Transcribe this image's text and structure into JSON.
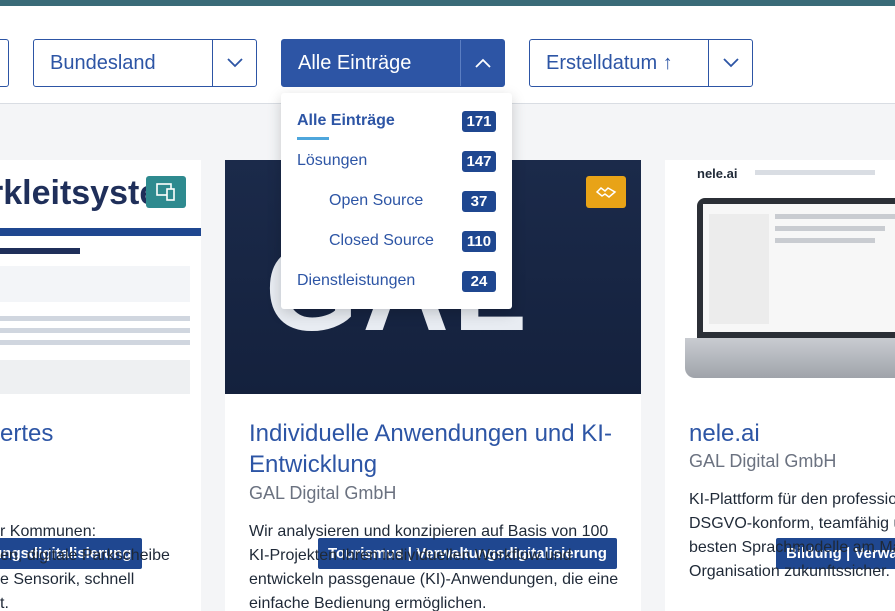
{
  "filters": {
    "bundesland": "Bundesland",
    "entries": "Alle Einträge",
    "sort": "Erstelldatum ↑"
  },
  "dropdown": {
    "options": [
      {
        "label": "Alle Einträge",
        "count": "171"
      },
      {
        "label": "Lösungen",
        "count": "147"
      },
      {
        "label": "Open Source",
        "count": "37"
      },
      {
        "label": "Closed Source",
        "count": "110"
      },
      {
        "label": "Dienstleistungen",
        "count": "24"
      }
    ]
  },
  "cards": [
    {
      "image_text": "rkleitsyster",
      "tag": "waltungsdigitalisierung",
      "title": "ertes",
      "description": [
        "r Kommunen:",
        "en, digitale Parkscheibe",
        "e Sensorik, schnell",
        "t."
      ],
      "icon": "devices-icon"
    },
    {
      "image_text": "GAL",
      "tag": "Tourismus | Verwaltungsdigitalisierung",
      "title": [
        "Individuelle Anwendungen und KI-",
        "Entwicklung"
      ],
      "company": "GAL Digital GmbH",
      "description": [
        "Wir analysieren und konzipieren auf Basis von 100",
        "KI-Projekten Ihren individuellen Workflow und",
        "entwickeln passgenaue (KI)-Anwendungen, die eine",
        "einfache Bedienung ermöglichen."
      ],
      "icon": "handshake-icon"
    },
    {
      "image_text": "nele.ai",
      "tag": "Bildung | Verwa",
      "title": "nele.ai",
      "company": "GAL Digital GmbH",
      "description": [
        "KI-Plattform für den professio",
        "DSGVO-konform, teamfähig u",
        "besten Sprachmodelle am Ma",
        "Organisation zukunftssicher."
      ]
    }
  ],
  "colors": {
    "accent": "#2d55a5",
    "badge": "#1f4790",
    "teal": "#2e8a8f",
    "amber": "#e8a317",
    "underline": "#4ea6dc"
  }
}
